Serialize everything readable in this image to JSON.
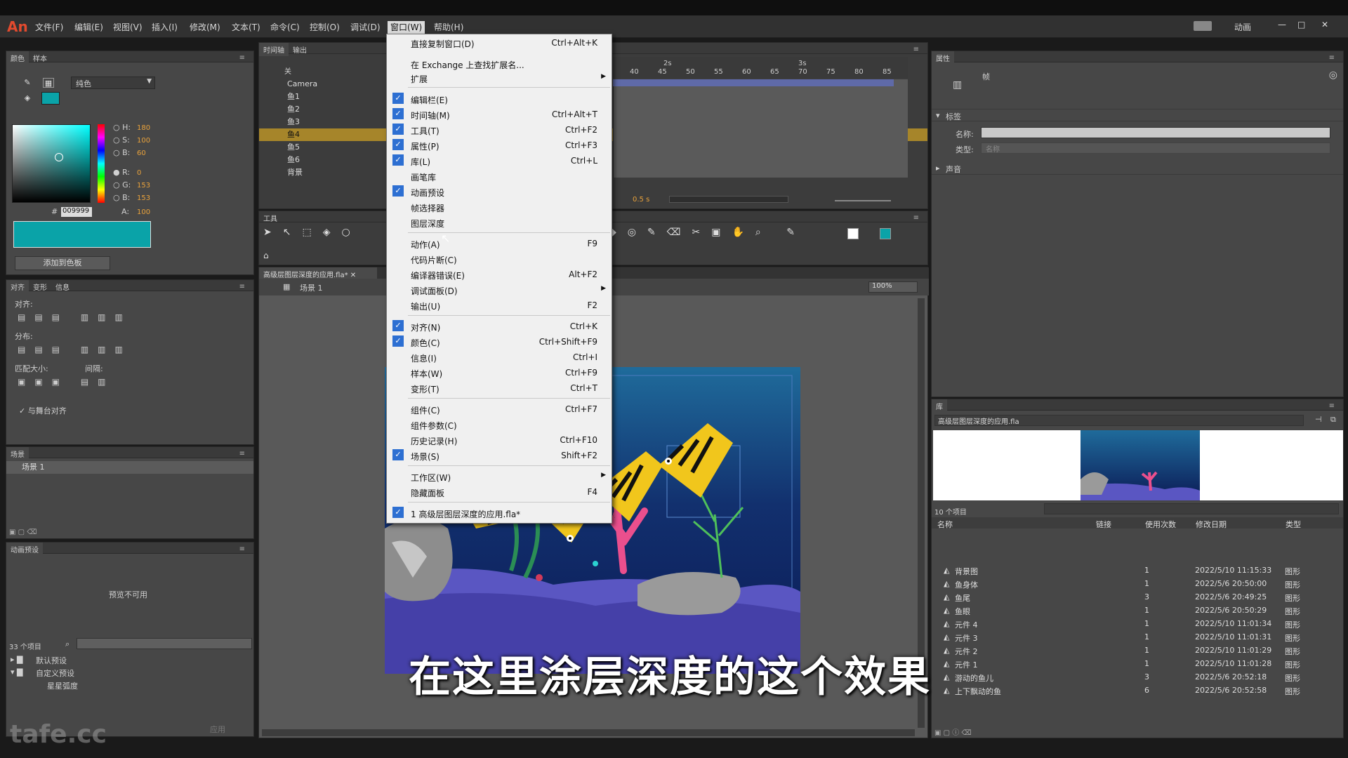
{
  "app": {
    "logo": "An",
    "workspace": "动画"
  },
  "menubar": [
    "文件(F)",
    "编辑(E)",
    "视图(V)",
    "插入(I)",
    "修改(M)",
    "文本(T)",
    "命令(C)",
    "控制(O)",
    "调试(D)",
    "窗口(W)",
    "帮助(H)"
  ],
  "color_panel": {
    "tabs": [
      "颜色",
      "样本"
    ],
    "fill_type": "纯色",
    "h": "180",
    "s": "100",
    "b": "60",
    "r": "0",
    "g": "153",
    "bl": "153",
    "hex": "009999",
    "alpha": "100",
    "add_swatch": "添加到色板",
    "swatch_color": "#0aa3a8"
  },
  "align_panel": {
    "tabs": [
      "对齐",
      "变形",
      "信息"
    ],
    "align": "对齐:",
    "distribute": "分布:",
    "match": "匹配大小:",
    "space": "间隔:",
    "to_stage": "与舞台对齐"
  },
  "scene_panel": {
    "title": "场景",
    "item": "场景 1"
  },
  "preset_panel": {
    "title": "动画预设",
    "preview": "预览不可用",
    "count": "33 个项目",
    "folders": [
      "默认预设",
      "自定义预设"
    ],
    "item": "星星弧度",
    "apply": "应用"
  },
  "timeline": {
    "tabs": [
      "时间轴",
      "输出"
    ],
    "layers_header": "关",
    "layers": [
      "Camera",
      "鱼1",
      "鱼2",
      "鱼3",
      "鱼4",
      "鱼5",
      "鱼6",
      "背景"
    ],
    "ruler": [
      "40",
      "45",
      "50",
      "55",
      "60",
      "65",
      "70",
      "75",
      "80",
      "85"
    ],
    "sec_marks": [
      "2s",
      "3s"
    ],
    "fps": "0.5 s"
  },
  "tools_label": "工具",
  "document": {
    "tab": "高级层图层深度的应用.fla*",
    "scene": "场景 1",
    "zoom": "100%"
  },
  "menu": {
    "items": [
      {
        "label": "直接复制窗口(D)",
        "shortcut": "Ctrl+Alt+K",
        "checked": false
      },
      {
        "label": "在 Exchange 上查找扩展名...",
        "shortcut": "",
        "checked": false
      },
      {
        "label": "扩展",
        "shortcut": "",
        "checked": false,
        "sub": true
      },
      {
        "label": "编辑栏(E)",
        "shortcut": "",
        "checked": true
      },
      {
        "label": "时间轴(M)",
        "shortcut": "Ctrl+Alt+T",
        "checked": true
      },
      {
        "label": "工具(T)",
        "shortcut": "Ctrl+F2",
        "checked": true
      },
      {
        "label": "属性(P)",
        "shortcut": "Ctrl+F3",
        "checked": true
      },
      {
        "label": "库(L)",
        "shortcut": "Ctrl+L",
        "checked": true
      },
      {
        "label": "画笔库",
        "shortcut": "",
        "checked": false
      },
      {
        "label": "动画预设",
        "shortcut": "",
        "checked": true
      },
      {
        "label": "帧选择器",
        "shortcut": "",
        "checked": false
      },
      {
        "label": "图层深度",
        "shortcut": "",
        "checked": false
      },
      {
        "label": "动作(A)",
        "shortcut": "F9",
        "checked": false
      },
      {
        "label": "代码片断(C)",
        "shortcut": "",
        "checked": false
      },
      {
        "label": "编译器错误(E)",
        "shortcut": "Alt+F2",
        "checked": false
      },
      {
        "label": "调试面板(D)",
        "shortcut": "",
        "checked": false,
        "sub": true
      },
      {
        "label": "输出(U)",
        "shortcut": "F2",
        "checked": false
      },
      {
        "label": "对齐(N)",
        "shortcut": "Ctrl+K",
        "checked": true
      },
      {
        "label": "颜色(C)",
        "shortcut": "Ctrl+Shift+F9",
        "checked": true
      },
      {
        "label": "信息(I)",
        "shortcut": "Ctrl+I",
        "checked": false
      },
      {
        "label": "样本(W)",
        "shortcut": "Ctrl+F9",
        "checked": false
      },
      {
        "label": "变形(T)",
        "shortcut": "Ctrl+T",
        "checked": false
      },
      {
        "label": "组件(C)",
        "shortcut": "Ctrl+F7",
        "checked": false
      },
      {
        "label": "组件参数(C)",
        "shortcut": "",
        "checked": false
      },
      {
        "label": "历史记录(H)",
        "shortcut": "Ctrl+F10",
        "checked": false
      },
      {
        "label": "场景(S)",
        "shortcut": "Shift+F2",
        "checked": true
      },
      {
        "label": "工作区(W)",
        "shortcut": "",
        "checked": false,
        "sub": true
      },
      {
        "label": "隐藏面板",
        "shortcut": "F4",
        "checked": false
      },
      {
        "label": "1 高级层图层深度的应用.fla*",
        "shortcut": "",
        "checked": true
      }
    ]
  },
  "properties": {
    "title": "属性",
    "frame": "帧",
    "label_section": "标签",
    "name_label": "名称:",
    "type_label": "类型:",
    "type_value": "名称",
    "sound_section": "声音"
  },
  "library": {
    "title": "库",
    "file": "高级层图层深度的应用.fla",
    "count": "10 个项目",
    "headers": [
      "名称",
      "链接",
      "使用次数",
      "修改日期",
      "类型"
    ],
    "rows": [
      [
        "背景图",
        "",
        "1",
        "2022/5/10 11:15:33",
        "图形"
      ],
      [
        "鱼身体",
        "",
        "1",
        "2022/5/6 20:50:00",
        "图形"
      ],
      [
        "鱼尾",
        "",
        "3",
        "2022/5/6 20:49:25",
        "图形"
      ],
      [
        "鱼眼",
        "",
        "1",
        "2022/5/6 20:50:29",
        "图形"
      ],
      [
        "元件 4",
        "",
        "1",
        "2022/5/10 11:01:34",
        "图形"
      ],
      [
        "元件 3",
        "",
        "1",
        "2022/5/10 11:01:31",
        "图形"
      ],
      [
        "元件 2",
        "",
        "1",
        "2022/5/10 11:01:29",
        "图形"
      ],
      [
        "元件 1",
        "",
        "1",
        "2022/5/10 11:01:28",
        "图形"
      ],
      [
        "游动的鱼儿",
        "",
        "3",
        "2022/5/6 20:52:18",
        "图形"
      ],
      [
        "上下飘动的鱼",
        "",
        "6",
        "2022/5/6 20:52:58",
        "图形"
      ]
    ]
  },
  "subtitle": "在这里涂层深度的这个效果",
  "watermark": "tafe.cc"
}
